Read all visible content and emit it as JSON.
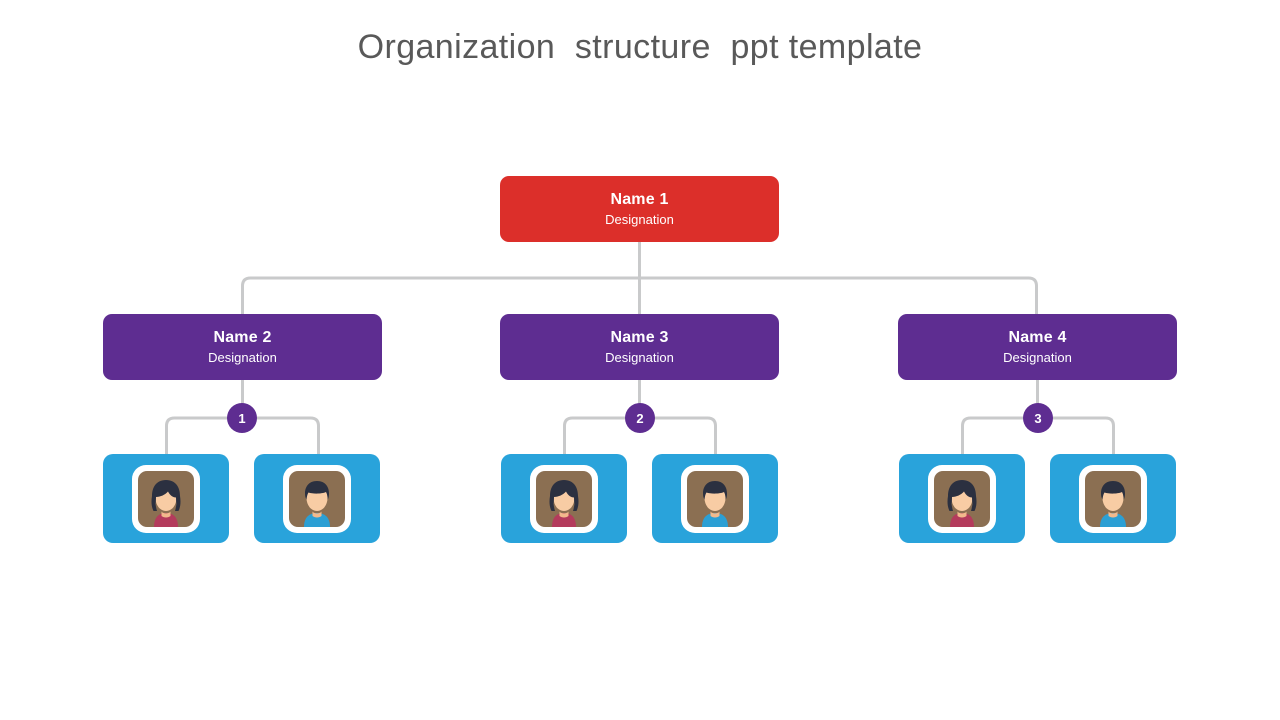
{
  "slide": {
    "title": "Organization  structure  ppt template",
    "background_color": "#ffffff",
    "title_color": "#595959"
  },
  "colors": {
    "root_red": "#DC2F2A",
    "level2_purple": "#5E2D91",
    "badge_purple": "#5E2D91",
    "tile_blue": "#29A3DB",
    "connector_gray": "#C9CACB",
    "avatar_background": "#8B6F52",
    "avatar_skin": "#F8CCA4",
    "avatar_hair": "#2B3040",
    "avatar_female_top": "#B33B5C",
    "avatar_male_top": "#2B9FD4",
    "frame_white": "#ffffff"
  },
  "chart_data": {
    "type": "diagram",
    "diagram_kind": "organization-chart",
    "levels": 3,
    "title": "Organization  structure  ppt template"
  },
  "org": {
    "root": {
      "name": "Name 1",
      "designation": "Designation",
      "color": "#DC2F2A"
    },
    "branches": [
      {
        "badge": "1",
        "node": {
          "name": "Name 2",
          "designation": "Designation",
          "color": "#5E2D91"
        },
        "members": [
          {
            "gender": "female",
            "icon": "female-avatar-icon"
          },
          {
            "gender": "male",
            "icon": "male-avatar-icon"
          }
        ]
      },
      {
        "badge": "2",
        "node": {
          "name": "Name 3",
          "designation": "Designation",
          "color": "#5E2D91"
        },
        "members": [
          {
            "gender": "female",
            "icon": "female-avatar-icon"
          },
          {
            "gender": "male",
            "icon": "male-avatar-icon"
          }
        ]
      },
      {
        "badge": "3",
        "node": {
          "name": "Name 4",
          "designation": "Designation",
          "color": "#5E2D91"
        },
        "members": [
          {
            "gender": "female",
            "icon": "female-avatar-icon"
          },
          {
            "gender": "male",
            "icon": "male-avatar-icon"
          }
        ]
      }
    ]
  }
}
